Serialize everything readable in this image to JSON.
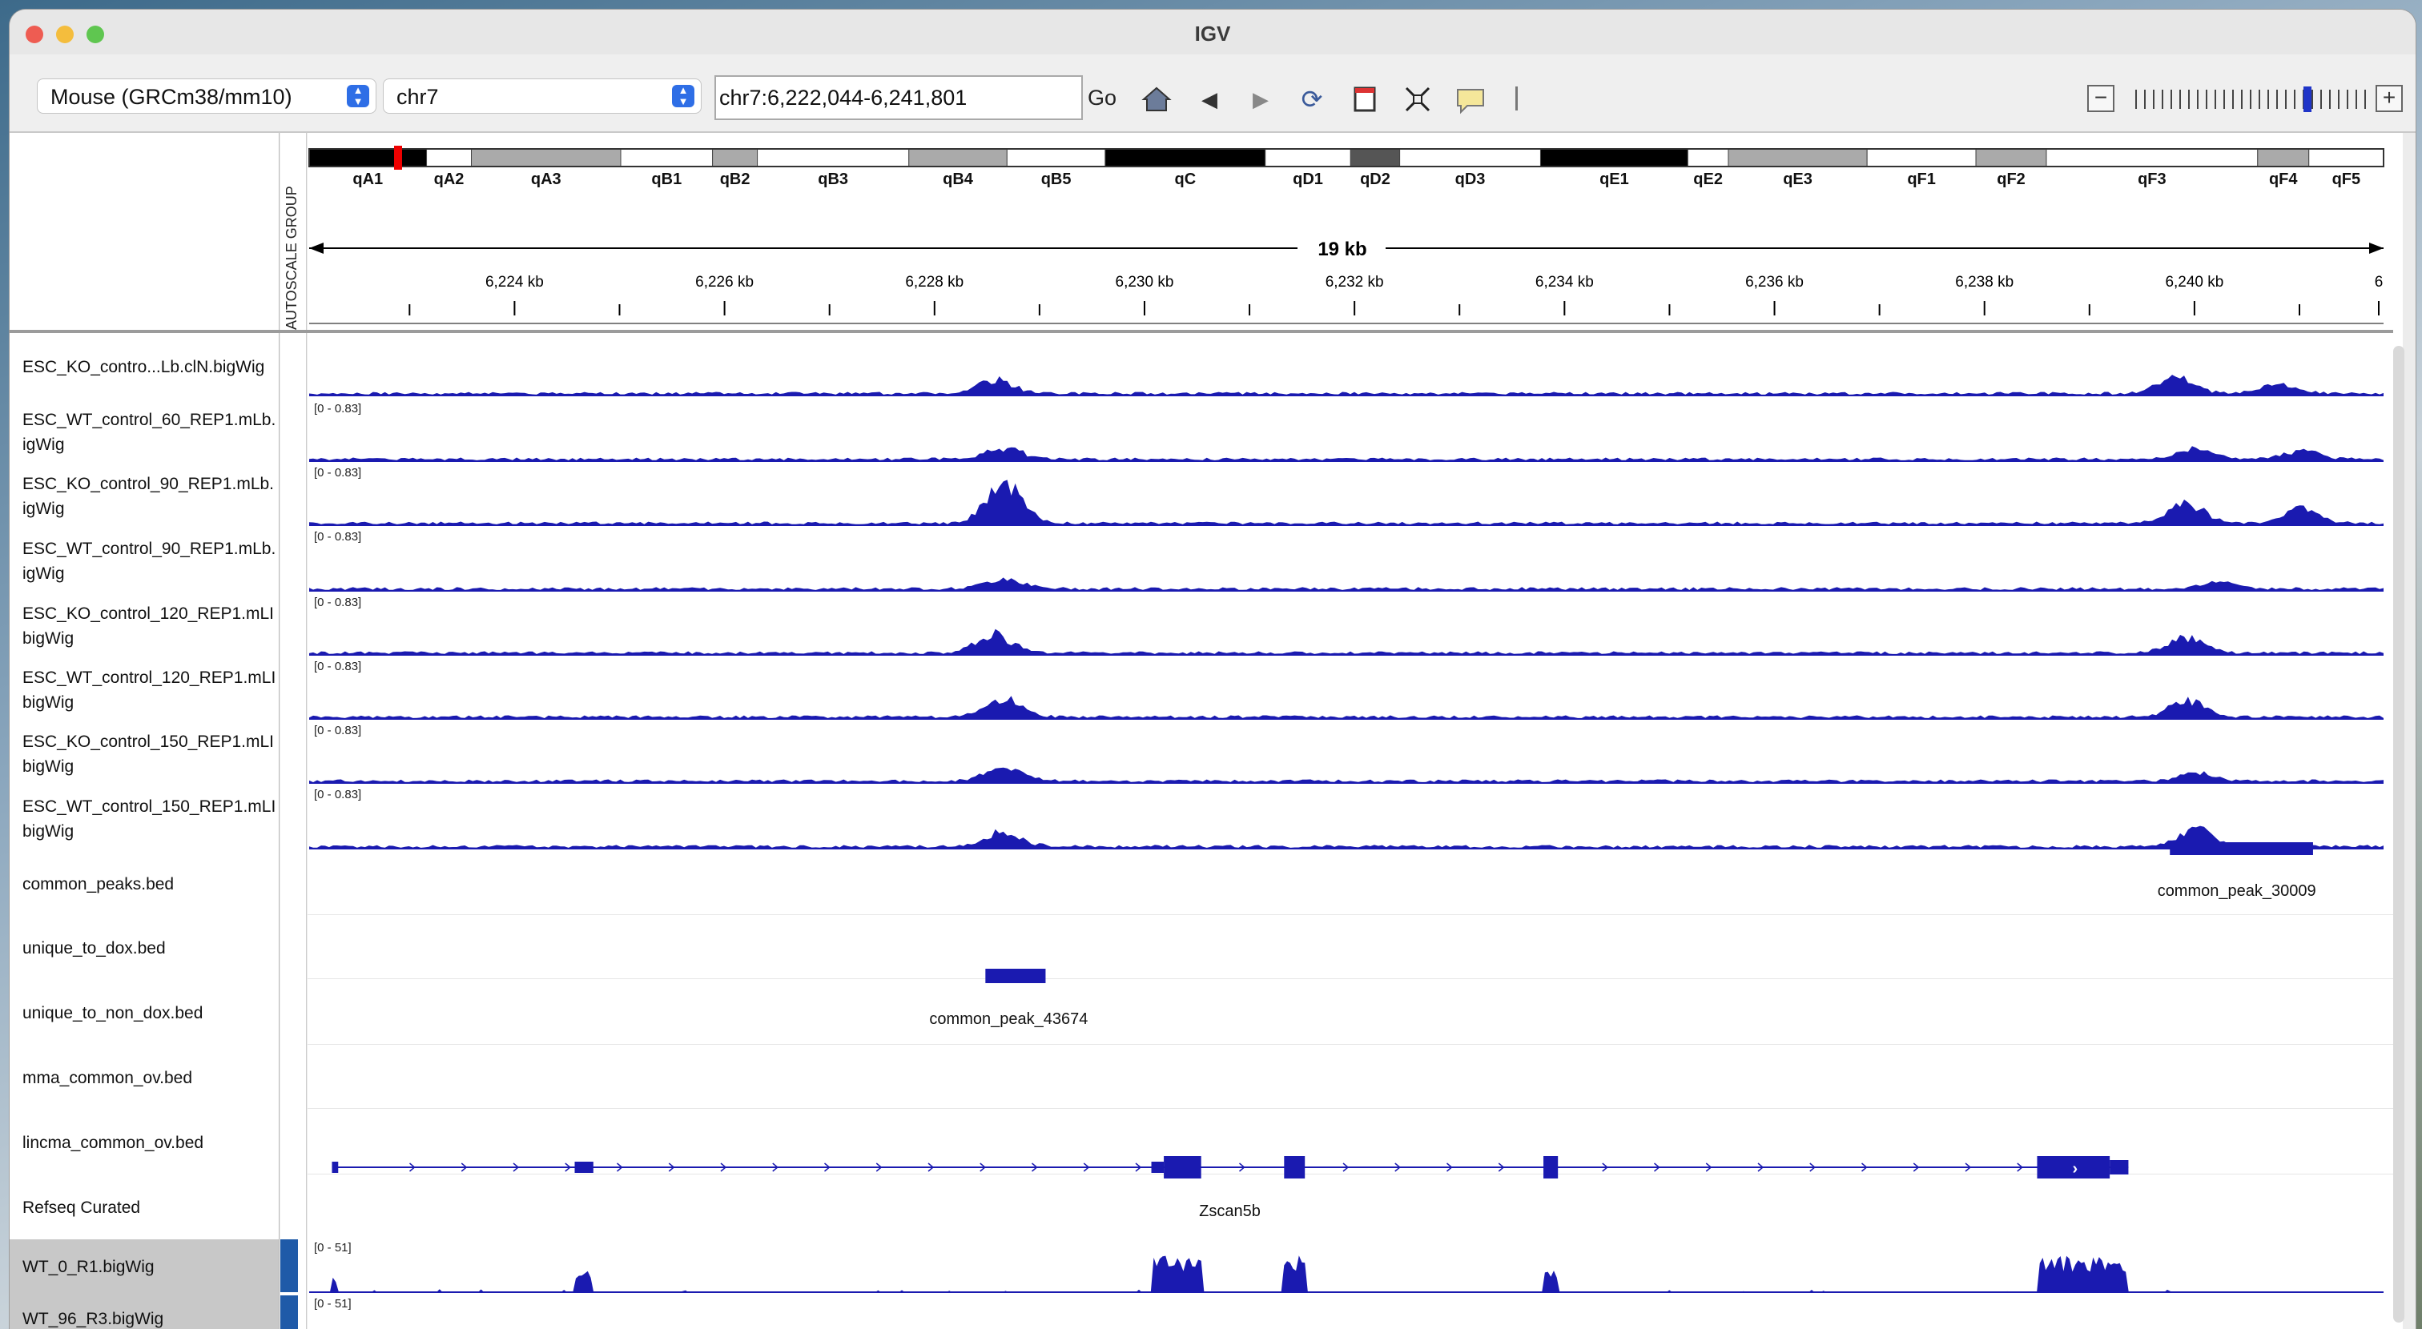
{
  "window": {
    "title": "IGV"
  },
  "toolbar": {
    "genome": "Mouse (GRCm38/mm10)",
    "chromosome": "chr7",
    "locus": "chr7:6,222,044-6,241,801",
    "go_label": "Go",
    "zoom_level": 0.75
  },
  "ideogram": {
    "bands": [
      "qA1",
      "qA2",
      "qA3",
      "qB1",
      "qB2",
      "qB3",
      "qB4",
      "qB5",
      "qC",
      "qD1",
      "qD2",
      "qD3",
      "qE1",
      "qE2",
      "qE3",
      "qF1",
      "qF2",
      "qF3",
      "qF4",
      "qF5"
    ]
  },
  "ruler": {
    "span_label": "19 kb",
    "ticks": [
      "6,224 kb",
      "6,226 kb",
      "6,228 kb",
      "6,230 kb",
      "6,232 kb",
      "6,234 kb",
      "6,236 kb",
      "6,238 kb",
      "6,240 kb",
      "6"
    ]
  },
  "attribute_header": "AUTOSCALE GROUP",
  "tracks": [
    {
      "name": "ESC_KO_contro...Lb.clN.bigWig",
      "range": ""
    },
    {
      "name": "ESC_WT_control_60_REP1.mLb.\nigWig",
      "range": "[0 - 0.83]"
    },
    {
      "name": "ESC_KO_control_90_REP1.mLb.\nigWig",
      "range": "[0 - 0.83]"
    },
    {
      "name": "ESC_WT_control_90_REP1.mLb.\nigWig",
      "range": "[0 - 0.83]"
    },
    {
      "name": "ESC_KO_control_120_REP1.mLI\nbigWig",
      "range": "[0 - 0.83]"
    },
    {
      "name": "ESC_WT_control_120_REP1.mLI\nbigWig",
      "range": "[0 - 0.83]"
    },
    {
      "name": "ESC_KO_control_150_REP1.mLI\nbigWig",
      "range": "[0 - 0.83]"
    },
    {
      "name": "ESC_WT_control_150_REP1.mLI\nbigWig",
      "range": "[0 - 0.83]"
    },
    {
      "name": "common_peaks.bed",
      "range": ""
    },
    {
      "name": "unique_to_dox.bed",
      "range": ""
    },
    {
      "name": "unique_to_non_dox.bed",
      "range": ""
    },
    {
      "name": "mma_common_ov.bed",
      "range": ""
    },
    {
      "name": "lincma_common_ov.bed",
      "range": ""
    },
    {
      "name": "Refseq Curated",
      "range": ""
    },
    {
      "name": "WT_0_R1.bigWig",
      "range": "[0 - 51]"
    },
    {
      "name": "WT_96_R3.bigWig",
      "range": "[0 - 51]"
    }
  ],
  "features": {
    "common_peak_a": "common_peak_30009",
    "common_peak_b": "common_peak_43674",
    "gene": "Zscan5b"
  },
  "colors": {
    "signal": "#1a1ab0",
    "feature": "#1a1ab0"
  }
}
